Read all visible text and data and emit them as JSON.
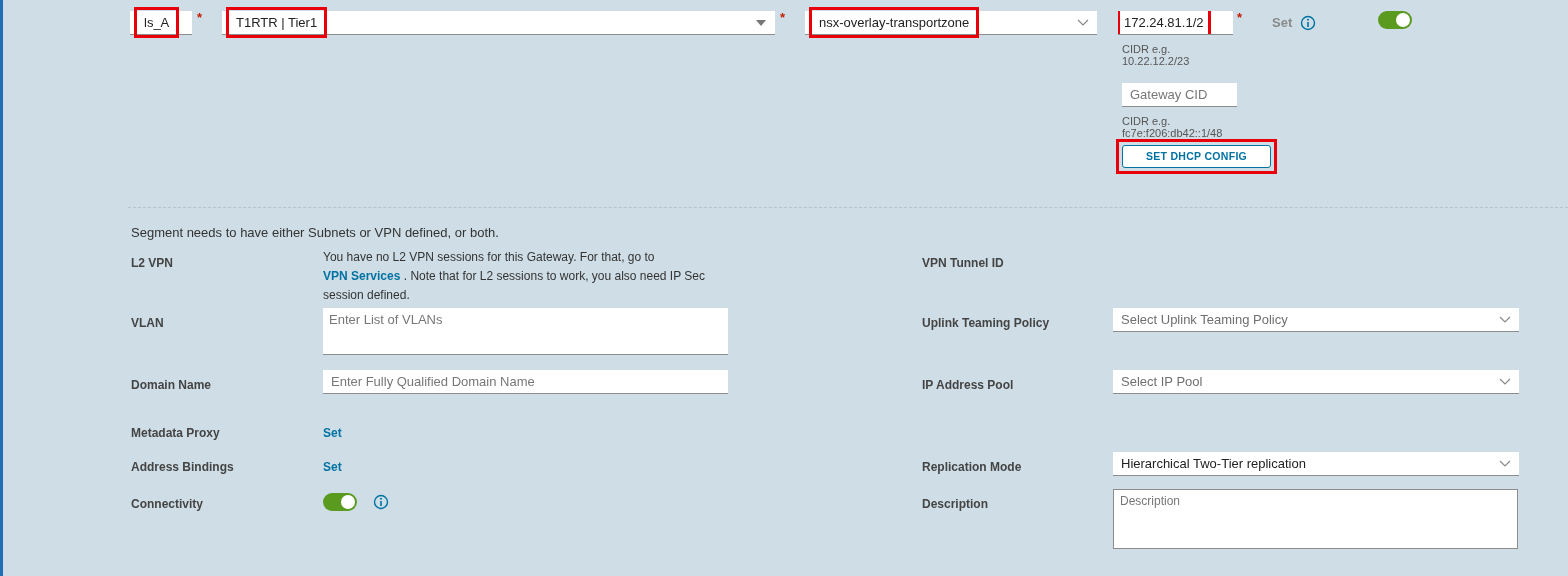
{
  "top_fields": [
    {
      "kind": "text",
      "value": "ls_A",
      "required_mark": "*",
      "highlighted": true
    },
    {
      "kind": "select",
      "value": "T1RTR | Tier1",
      "required_mark": "*",
      "highlighted": true
    },
    {
      "kind": "combobox",
      "value": "nsx-overlay-transportzone",
      "highlighted": true
    }
  ],
  "subnets": {
    "value": "172.24.81.1/2",
    "required_mark": "*",
    "highlighted": true,
    "hint": "CIDR e.g. 10.22.12.2/23",
    "gateway_placeholder": "Gateway CID",
    "gateway_hint": "CIDR e.g. fc7e:f206:db42::1/48",
    "dhcp_button": {
      "label": "SET DHCP CONFIG",
      "highlighted": true
    }
  },
  "dhcp_set": {
    "label": "Set",
    "disabled": true
  },
  "admin_toggle": {
    "on": true
  },
  "notice": "Segment needs to have either Subnets or VPN defined, or both.",
  "rows": [
    {
      "left": {
        "label": "L2 VPN",
        "kind": "message",
        "text": "You have no L2 VPN sessions for this Gateway. For that, go to ",
        "link": "VPN Services",
        "text_after": " . Note that for L2 sessions to work, you also need IP Sec session defined."
      },
      "right": {
        "label": "VPN Tunnel ID",
        "kind": "none"
      }
    },
    {
      "left": {
        "label": "VLAN",
        "kind": "textarea",
        "placeholder": "Enter List of VLANs"
      },
      "right": {
        "label": "Uplink Teaming Policy",
        "kind": "select",
        "placeholder": "Select Uplink Teaming Policy"
      }
    },
    {
      "left": {
        "label": "Domain Name",
        "kind": "input",
        "placeholder": "Enter Fully Qualified Domain Name"
      },
      "right": {
        "label": "IP Address Pool",
        "kind": "select",
        "placeholder": "Select IP Pool"
      }
    },
    {
      "left": {
        "label": "Metadata Proxy",
        "kind": "link",
        "link": "Set"
      },
      "right": {
        "kind": "none"
      }
    },
    {
      "left": {
        "label": "Address Bindings",
        "kind": "link",
        "link": "Set"
      },
      "right": {
        "label": "Replication Mode",
        "kind": "select",
        "value": "Hierarchical Two-Tier replication"
      }
    },
    {
      "left": {
        "label": "Connectivity",
        "kind": "toggle",
        "on": true
      },
      "right": {
        "label": "Description",
        "kind": "textarea",
        "placeholder": "Description"
      }
    }
  ]
}
